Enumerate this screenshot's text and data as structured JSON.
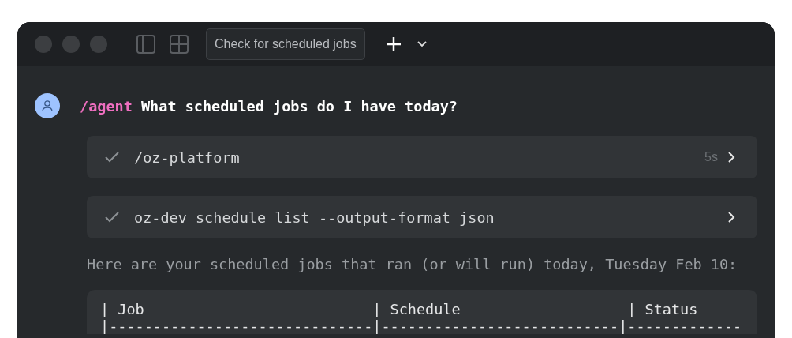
{
  "window": {
    "tab_title": "Check for scheduled jobs"
  },
  "prompt": {
    "command": "/agent",
    "text": "What scheduled jobs do I have today?"
  },
  "steps": [
    {
      "label": "/oz-platform",
      "duration": "5s",
      "done": true
    },
    {
      "label": "oz-dev schedule list --output-format json",
      "done": true
    }
  ],
  "reply": "Here are your scheduled jobs that ran (or will run) today, Tuesday Feb 10:",
  "code_block": {
    "lines": [
      "| Job                          | Schedule                   | Status",
      "|------------------------------|---------------------------|-------------"
    ]
  }
}
